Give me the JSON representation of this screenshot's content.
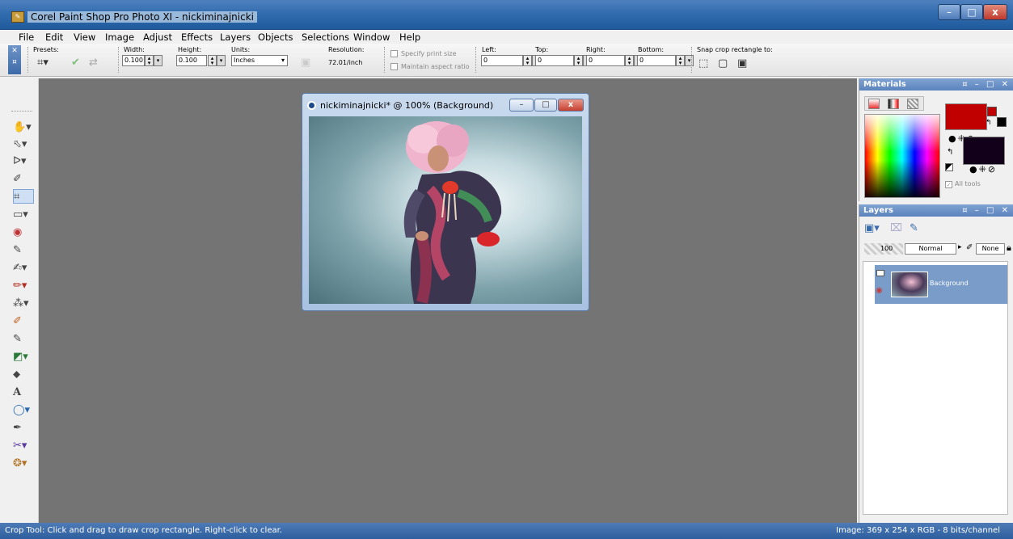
{
  "window": {
    "title": "Corel Paint Shop Pro Photo XI - nickiminajnicki",
    "minimize": "–",
    "maximize": "□",
    "close": "x"
  },
  "menu": [
    "File",
    "Edit",
    "View",
    "Image",
    "Adjust",
    "Effects",
    "Layers",
    "Objects",
    "Selections",
    "Window",
    "Help"
  ],
  "toolbar": {
    "presets_label": "Presets:",
    "width_label": "Width:",
    "width_value": "0.100",
    "height_label": "Height:",
    "height_value": "0.100",
    "units_label": "Units:",
    "units_value": "Inches",
    "resolution_label": "Resolution:",
    "resolution_value": "72.01/inch",
    "specify_print_size": "Specify print size",
    "maintain_aspect_ratio": "Maintain aspect ratio",
    "left_label": "Left:",
    "left_value": "0",
    "top_label": "Top:",
    "top_value": "0",
    "right_label": "Right:",
    "right_value": "0",
    "bottom_label": "Bottom:",
    "bottom_value": "0",
    "snap_label": "Snap crop rectangle to:"
  },
  "document": {
    "title": "nickiminajnicki* @ 100% (Background)"
  },
  "materials": {
    "title": "Materials",
    "all_tools": "All tools",
    "foreground_color": "#c00000",
    "background_color": "#12001a"
  },
  "layers": {
    "title": "Layers",
    "opacity": "100",
    "blend_mode": "Normal",
    "mask_mode": "None",
    "layer_name": "Background"
  },
  "status": {
    "left": "Crop Tool: Click and drag to draw crop rectangle. Right-click to clear.",
    "right": "Image:  369 x 254 x RGB - 8 bits/channel"
  }
}
